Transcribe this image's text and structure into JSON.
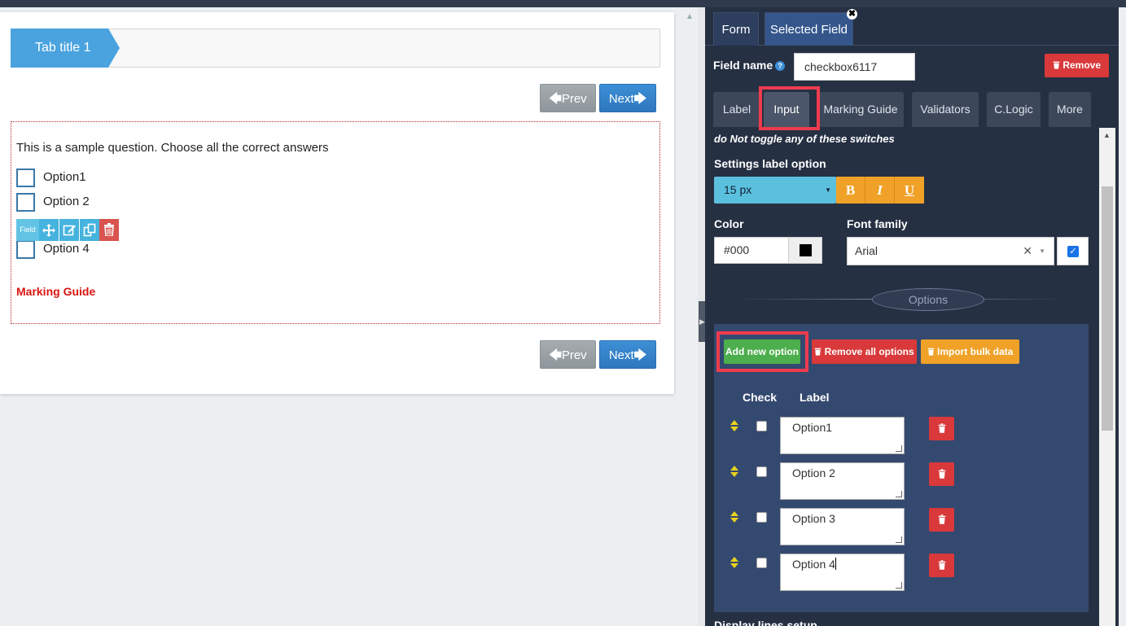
{
  "canvas": {
    "tab_title": "Tab title 1",
    "prev_label": "Prev",
    "next_label": "Next",
    "question": "This is a sample question. Choose all the correct answers",
    "options": [
      "Option1",
      "Option 2",
      "Option 4"
    ],
    "field_toolbar_label": "Field",
    "marking_guide": "Marking Guide"
  },
  "panel": {
    "tabs": {
      "form": "Form",
      "selected_field": "Selected Field"
    },
    "field_name_label": "Field name",
    "help_glyph": "?",
    "field_name_value": "checkbox6117",
    "remove_label": "Remove",
    "subtabs": [
      "Label",
      "Input",
      "Marking Guide",
      "Validators",
      "C.Logic",
      "More"
    ],
    "note": "do Not toggle any of these switches",
    "settings_label_option": "Settings label option",
    "font_size": "15 px",
    "format_buttons": {
      "bold": "B",
      "italic": "I",
      "underline": "U"
    },
    "color_label": "Color",
    "color_value": "#000",
    "font_family_label": "Font family",
    "font_family_value": "Arial",
    "options_title": "Options",
    "add_option": "Add new option",
    "remove_all": "Remove all options",
    "import_bulk": "Import bulk data",
    "col_check": "Check",
    "col_label": "Label",
    "option_rows": [
      "Option1",
      "Option 2",
      "Option 3",
      "Option 4"
    ],
    "bottom_partial": "Display lines setup"
  },
  "colors": {
    "accent_blue": "#4aa3df",
    "panel_bg": "#263043",
    "highlight_red": "#ef3b4e",
    "add_green": "#4cae4c",
    "danger_red": "#d9393a",
    "warning_orange": "#f0a127",
    "info_cyan": "#5bc0de"
  },
  "icons": [
    "move-icon",
    "edit-icon",
    "copy-icon",
    "trash-icon",
    "help-icon",
    "sort-arrows-icon",
    "close-icon",
    "checkmark-icon"
  ]
}
